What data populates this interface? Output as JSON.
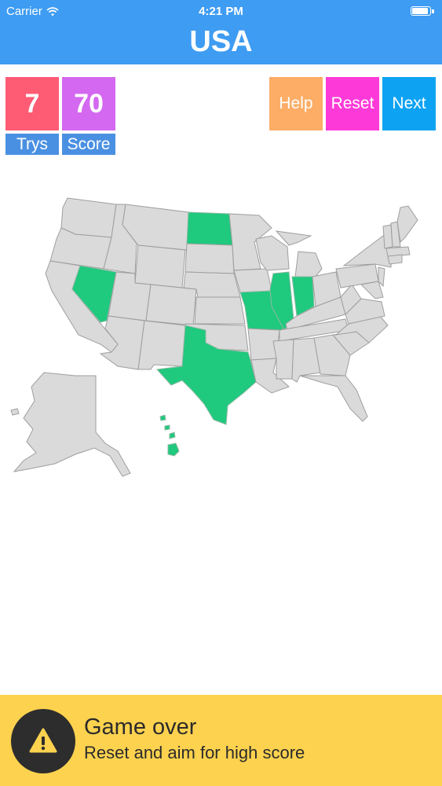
{
  "status": {
    "carrier": "Carrier",
    "time": "4:21 PM"
  },
  "header": {
    "title": "USA"
  },
  "stats": {
    "trys_value": "7",
    "trys_label": "Trys",
    "score_value": "70",
    "score_label": "Score"
  },
  "buttons": {
    "help": "Help",
    "reset": "Reset",
    "next": "Next"
  },
  "colors": {
    "header": "#3e9cf2",
    "trys": "#fe5b74",
    "score": "#d468f1",
    "label": "#4a90e2",
    "help": "#fdad66",
    "reset": "#fd3ad8",
    "next": "#0ea3f2",
    "correct_state": "#1fc97e",
    "state": "#dadada",
    "banner": "#fdd24f"
  },
  "map": {
    "correct_states": [
      "North Dakota",
      "Nevada",
      "Texas",
      "Missouri",
      "Illinois",
      "Indiana",
      "Hawaii"
    ]
  },
  "banner": {
    "title": "Game over",
    "subtitle": "Reset and aim for high score",
    "icon": "warning-icon"
  }
}
